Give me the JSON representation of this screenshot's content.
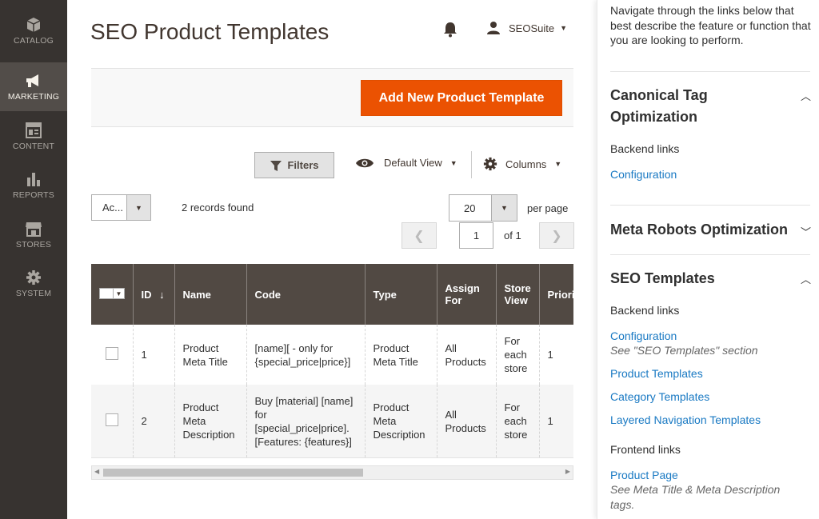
{
  "sidebar": {
    "items": [
      {
        "label": "CATALOG",
        "icon": "catalog-icon"
      },
      {
        "label": "MARKETING",
        "icon": "marketing-icon",
        "active": true
      },
      {
        "label": "CONTENT",
        "icon": "content-icon"
      },
      {
        "label": "REPORTS",
        "icon": "reports-icon"
      },
      {
        "label": "STORES",
        "icon": "stores-icon"
      },
      {
        "label": "SYSTEM",
        "icon": "system-icon"
      }
    ]
  },
  "header": {
    "title": "SEO Product Templates",
    "user": "SEOSuite"
  },
  "toolbar": {
    "add_label": "Add New Product Template",
    "filters_label": "Filters",
    "view_label": "Default View",
    "columns_label": "Columns",
    "actions_value": "Ac...",
    "records_text": "2 records found",
    "per_page_value": "20",
    "per_page_label": "per page",
    "page_value": "1",
    "page_of": "of 1"
  },
  "grid": {
    "headers": [
      "ID",
      "Name",
      "Code",
      "Type",
      "Assign For",
      "Store View",
      "Priority"
    ],
    "sort_indicator": "↓",
    "rows": [
      {
        "id": "1",
        "name": "Product Meta Title",
        "code": "[name][ - only for {special_price|price}]",
        "type": "Product Meta Title",
        "assign": "All Products",
        "store": "For each store",
        "priority": "1"
      },
      {
        "id": "2",
        "name": "Product Meta Description",
        "code": "Buy [material] [name] for [special_price|price]. [Features: {features}]",
        "type": "Product Meta Description",
        "assign": "All Products",
        "store": "For each store",
        "priority": "1"
      }
    ]
  },
  "panel": {
    "intro": "Navigate through the links below that best describe the feature or function that you are looking to perform.",
    "sections": [
      {
        "title": "Canonical Tag Optimization",
        "backend_label": "Backend links",
        "links": [
          "Configuration"
        ]
      },
      {
        "title": "Meta Robots Optimization"
      },
      {
        "title": "SEO Templates",
        "backend_label": "Backend links",
        "config_link": "Configuration",
        "config_note": "See \"SEO Templates\" section",
        "links": [
          "Product Templates",
          "Category Templates",
          "Layered Navigation Templates"
        ],
        "frontend_label": "Frontend links",
        "frontend_link": "Product Page",
        "frontend_note": "See Meta Title & Meta Description tags."
      }
    ]
  },
  "colors": {
    "accent": "#eb5202",
    "sidebar": "#373330",
    "grid_header": "#514943",
    "link": "#1979c3"
  }
}
